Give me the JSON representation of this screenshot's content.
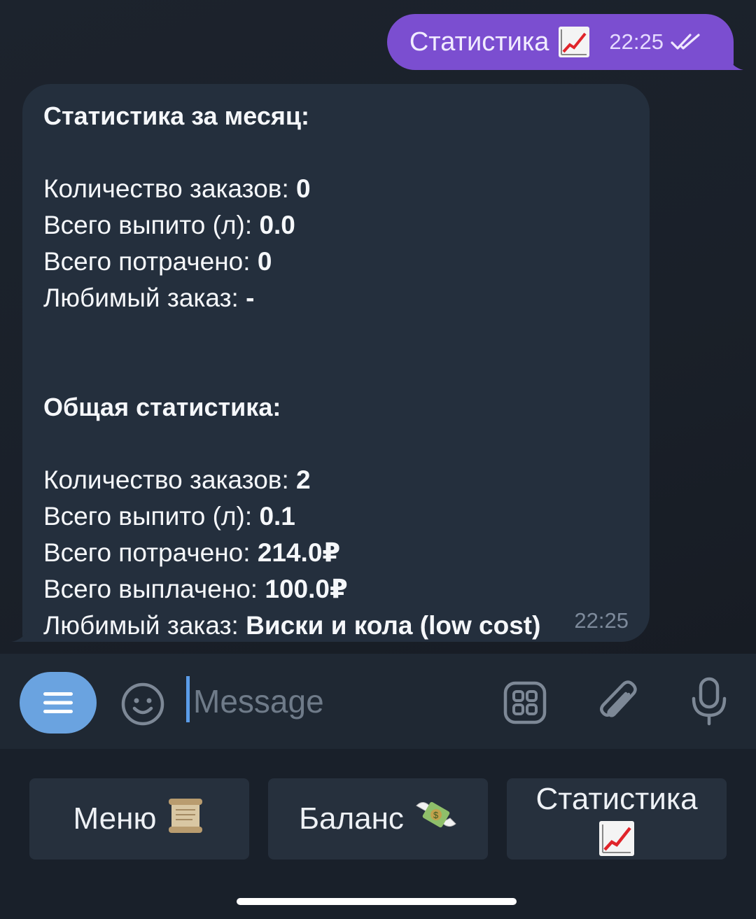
{
  "outgoing": {
    "text": "Статистика",
    "time": "22:25"
  },
  "incoming": {
    "month_heading": "Статистика за месяц:",
    "month_rows": [
      {
        "label": "Количество заказов: ",
        "value": "0"
      },
      {
        "label": "Всего выпито (л): ",
        "value": "0.0"
      },
      {
        "label": "Всего потрачено: ",
        "value": "0"
      },
      {
        "label": "Любимый заказ: ",
        "value": "-"
      }
    ],
    "total_heading": "Общая статистика:",
    "total_rows": [
      {
        "label": "Количество заказов: ",
        "value": "2"
      },
      {
        "label": "Всего выпито (л): ",
        "value": "0.1"
      },
      {
        "label": "Всего потрачено: ",
        "value": "214.0₽"
      },
      {
        "label": "Всего выплачено: ",
        "value": "100.0₽"
      },
      {
        "label": "Любимый заказ: ",
        "value": "Виски и кола (low cost)"
      }
    ],
    "time": "22:25"
  },
  "input": {
    "placeholder": "Message"
  },
  "keyboard": {
    "buttons": [
      {
        "label": "Меню",
        "icon": "scroll-icon"
      },
      {
        "label": "Баланс",
        "icon": "money-with-wings-icon"
      },
      {
        "label": "Статистика",
        "icon": "chart-increasing-icon"
      }
    ]
  },
  "colors": {
    "accent": "#7b4ed0",
    "menu_button": "#6aa3e0",
    "incoming_bubble": "#242f3d",
    "background": "#1b222c"
  }
}
